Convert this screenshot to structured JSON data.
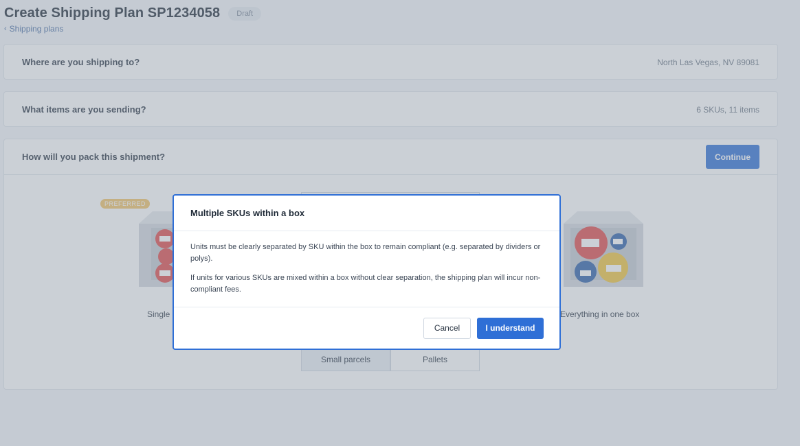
{
  "header": {
    "title": "Create Shipping Plan SP1234058",
    "status": "Draft",
    "breadcrumb_label": "Shipping plans"
  },
  "destination": {
    "question": "Where are you shipping to?",
    "summary": "North Las Vegas, NV 89081"
  },
  "items": {
    "question": "What items are you sending?",
    "summary": "6 SKUs, 11 items"
  },
  "packing": {
    "question": "How will you pack this shipment?",
    "continue_label": "Continue",
    "preferred_badge": "PREFERRED",
    "options": [
      {
        "label": "Single"
      },
      {
        "label": "Everything in one box"
      }
    ],
    "shipment_types": [
      {
        "label": "Small parcels",
        "active": true
      },
      {
        "label": "Pallets",
        "active": false
      }
    ]
  },
  "modal": {
    "title": "Multiple SKUs within a box",
    "paragraph1": "Units must be clearly separated by SKU within the box to remain compliant (e.g. separated by dividers or polys).",
    "paragraph2": "If units for various SKUs are mixed within a box without clear separation, the shipping plan will incur non-compliant fees.",
    "cancel_label": "Cancel",
    "confirm_label": "I understand"
  },
  "colors": {
    "primary": "#2f6fd6",
    "preferred": "#f3c466",
    "overlay": "rgba(140,150,165,0.45)"
  },
  "icons": [
    "chevron-left-icon",
    "box-single-sku-icon",
    "box-mixed-sku-icon"
  ]
}
